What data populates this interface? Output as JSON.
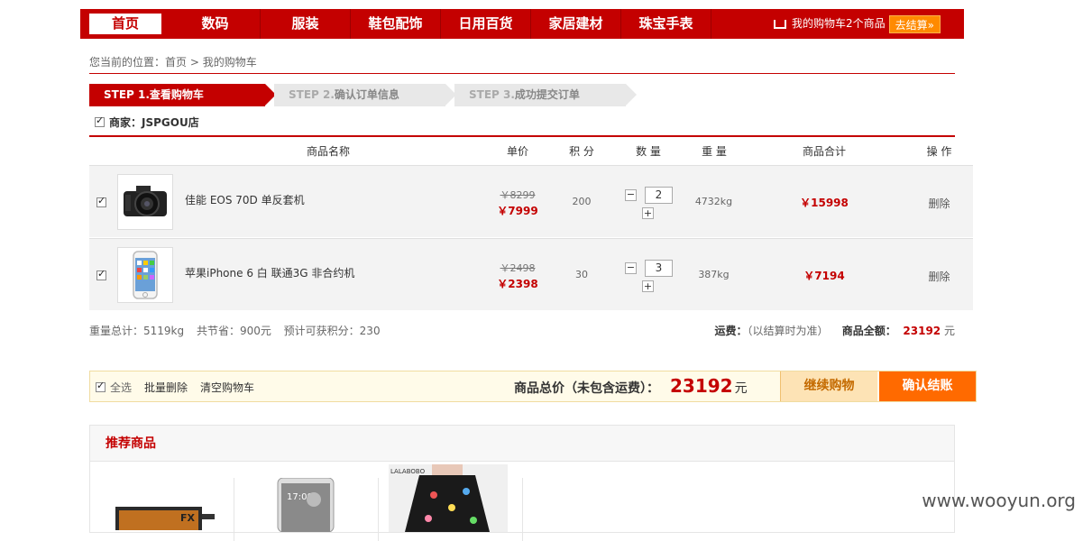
{
  "nav": {
    "items": [
      "首页",
      "数码",
      "服装",
      "鞋包配饰",
      "日用百货",
      "家居建材",
      "珠宝手表"
    ],
    "cart_text": "我的购物车2个商品",
    "cart_button": "去结算»"
  },
  "breadcrumb": {
    "prefix": "您当前的位置：",
    "home": "首页",
    "sep": " > ",
    "current": "我的购物车"
  },
  "steps": [
    {
      "num": "STEP 1.",
      "label": "查看购物车"
    },
    {
      "num": "STEP 2.",
      "label": "确认订单信息"
    },
    {
      "num": "STEP 3.",
      "label": "成功提交订单"
    }
  ],
  "merchant": "商家：JSPGOU店",
  "table": {
    "headers": [
      "商品名称",
      "单价",
      "积 分",
      "数 量",
      "重 量",
      "商品合计",
      "操 作"
    ],
    "rows": [
      {
        "name": "佳能 EOS 70D 单反套机",
        "price_old": "￥8299",
        "price_new": "￥7999",
        "points": "200",
        "qty": "2",
        "weight": "4732kg",
        "subtotal": "￥15998",
        "action": "删除",
        "image": "camera-icon"
      },
      {
        "name": "苹果iPhone 6  白 联通3G 非合约机",
        "price_old": "￥2498",
        "price_new": "￥2398",
        "points": "30",
        "qty": "3",
        "weight": "387kg",
        "subtotal": "￥7194",
        "action": "删除",
        "image": "phone-icon"
      }
    ]
  },
  "summary": {
    "weight": "重量总计：5119kg",
    "saved": "共节省：900元",
    "points": "预计可获积分：230",
    "freight_label": "运费：",
    "freight_value": "（以结算时为准）",
    "total_label": "商品全额：",
    "total_value": "23192",
    "total_unit": "元"
  },
  "bar": {
    "select_all": "全选",
    "batch_delete": "批量删除",
    "clear": "清空购物车",
    "total_label": "商品总价（未包含运费）：",
    "total_value": "23192",
    "total_unit": "元",
    "continue": "继续购物",
    "confirm": "确认结账"
  },
  "recommend": {
    "title": "推荐商品"
  },
  "watermark": "www.wooyun.org",
  "colors": {
    "brand": "#c40000",
    "accent": "#ff6a00"
  }
}
